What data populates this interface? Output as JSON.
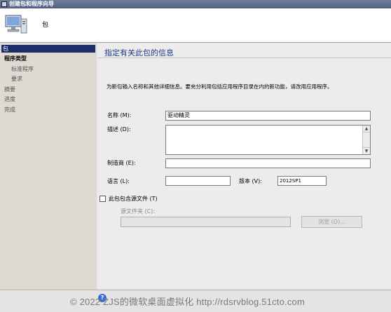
{
  "window": {
    "title": "创建包和程序向导"
  },
  "header": {
    "title": "包"
  },
  "sidebar": {
    "items": [
      {
        "label": "包"
      },
      {
        "label": "程序类型"
      },
      {
        "label": "标准程序"
      },
      {
        "label": "要求"
      },
      {
        "label": "摘要"
      },
      {
        "label": "进度"
      },
      {
        "label": "完成"
      }
    ]
  },
  "main": {
    "page_title": "指定有关此包的信息",
    "description": "为新包输入名称和其他详细信息。要充分利用包括应用程序目录在内的新功能，请改用应用程序。",
    "name_label": "名称 (M):",
    "name_value": "驱动精灵",
    "description_label": "描述 (D):",
    "manufacturer_label": "制造商 (E):",
    "language_label": "语言 (L):",
    "version_label": "版本 (V):",
    "version_value": "2012SP1",
    "source_checkbox_label": "此包包含源文件 (T)",
    "source_folder_label": "源文件夹 (C):",
    "browse_button": "浏览 (O)..."
  },
  "footer": {
    "watermark": "© 2022 ZJS的微软桌面虚拟化 http://rdsrvblog.51cto.com",
    "help_label": "?"
  }
}
